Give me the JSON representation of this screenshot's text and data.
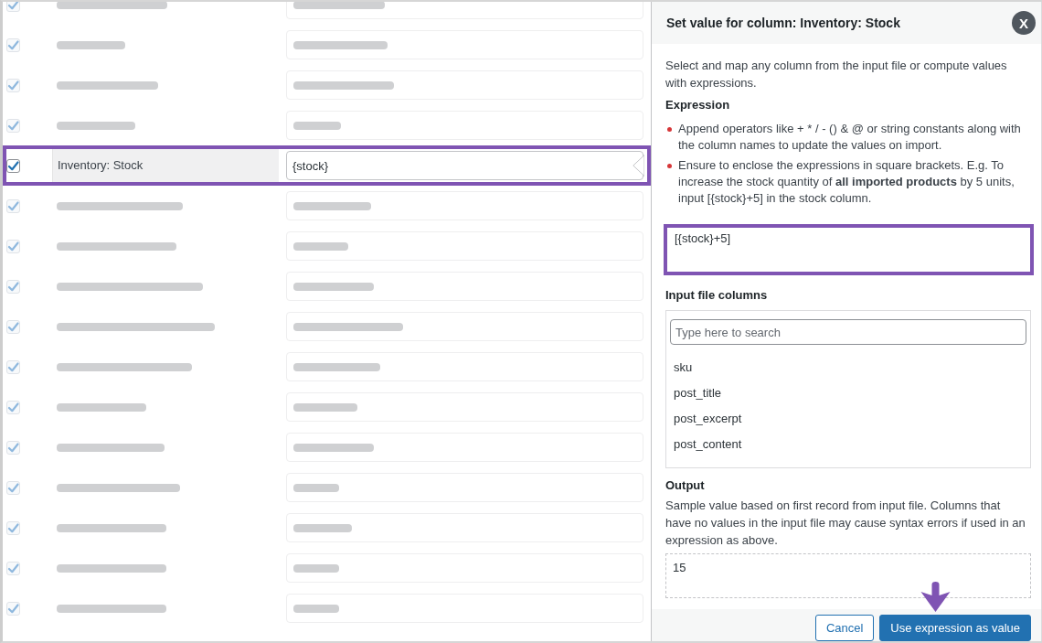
{
  "field_mappings": [
    {
      "checked": true,
      "selected": false,
      "blurred": true,
      "highlighted": false
    },
    {
      "checked": true,
      "selected": false,
      "blurred": true,
      "highlighted": false
    },
    {
      "checked": true,
      "selected": false,
      "blurred": true,
      "highlighted": false
    },
    {
      "checked": true,
      "selected": false,
      "blurred": true,
      "highlighted": false
    },
    {
      "field": "Inventory: Stock",
      "value": "{stock}",
      "checked": true,
      "selected": true,
      "blurred": false,
      "highlighted": true
    },
    {
      "checked": true,
      "selected": false,
      "blurred": true,
      "highlighted": false
    },
    {
      "checked": true,
      "selected": false,
      "blurred": true,
      "highlighted": false
    },
    {
      "checked": true,
      "selected": false,
      "blurred": true,
      "highlighted": false
    },
    {
      "checked": true,
      "selected": false,
      "blurred": true,
      "highlighted": false
    },
    {
      "checked": true,
      "selected": false,
      "blurred": true,
      "highlighted": false
    },
    {
      "checked": true,
      "selected": false,
      "blurred": true,
      "highlighted": false
    },
    {
      "checked": true,
      "selected": false,
      "blurred": true,
      "highlighted": false
    },
    {
      "checked": true,
      "selected": false,
      "blurred": true,
      "highlighted": false
    },
    {
      "checked": true,
      "selected": false,
      "blurred": true,
      "highlighted": false
    },
    {
      "checked": true,
      "selected": false,
      "blurred": true,
      "highlighted": false
    },
    {
      "checked": true,
      "selected": false,
      "blurred": true,
      "highlighted": false
    }
  ],
  "side_panel": {
    "title": "Set value for column: Inventory: Stock",
    "close_button": "X",
    "intro": "Select and map any column from the input file or compute values with expressions.",
    "expression_heading": "Expression",
    "hints": [
      "Append operators like + * / - () & @ or string constants along with the column names to update the values on import.",
      "Ensure to enclose the expressions in square brackets. E.g. To increase the stock quantity of **all imported products** by 5 units, input [{stock}+5] in the stock column."
    ],
    "expression": {
      "value": "[{stock}+5]",
      "highlighted": true
    },
    "columns_heading": "Input file columns",
    "columns_search": {
      "placeholder": "Type here to search"
    },
    "input_columns": [
      {
        "label": "sku",
        "selected": false
      },
      {
        "label": "post_title",
        "selected": false
      },
      {
        "label": "post_excerpt",
        "selected": false
      },
      {
        "label": "post_content",
        "selected": false
      }
    ],
    "output_heading": "Output",
    "output_note": "Sample value based on first record from input file. Columns that have no values in the input file may cause syntax errors if used in an expression as above.",
    "output_value": "15",
    "buttons": [
      {
        "label": "Cancel",
        "kind": "secondary"
      },
      {
        "label": "Use expression as value",
        "kind": "primary"
      }
    ]
  }
}
